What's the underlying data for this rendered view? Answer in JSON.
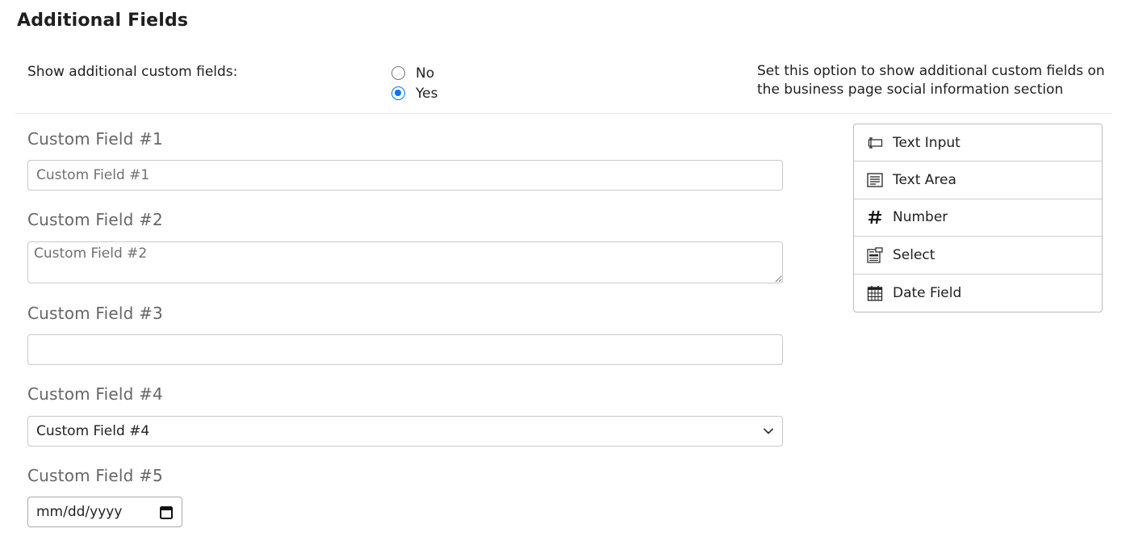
{
  "section": {
    "title": "Additional Fields"
  },
  "show_option": {
    "label": "Show additional custom fields:",
    "options": [
      {
        "label": "No",
        "checked": false
      },
      {
        "label": "Yes",
        "checked": true
      }
    ],
    "help": "Set this option to show additional custom fields on the business page social information section"
  },
  "fields": [
    {
      "label": "Custom Field #1",
      "type": "text",
      "value": "",
      "placeholder": "Custom Field #1"
    },
    {
      "label": "Custom Field #2",
      "type": "textarea",
      "value": "",
      "placeholder": "Custom Field #2"
    },
    {
      "label": "Custom Field #3",
      "type": "number",
      "value": "",
      "placeholder": ""
    },
    {
      "label": "Custom Field #4",
      "type": "select",
      "selected": "Custom Field #4"
    },
    {
      "label": "Custom Field #5",
      "type": "date",
      "placeholder": "mm/dd/yyyy"
    }
  ],
  "toolbox": {
    "items": [
      {
        "label": "Text Input",
        "icon": "text-input-icon"
      },
      {
        "label": "Text Area",
        "icon": "text-area-icon"
      },
      {
        "label": "Number",
        "icon": "hash-icon"
      },
      {
        "label": "Select",
        "icon": "select-icon"
      },
      {
        "label": "Date Field",
        "icon": "calendar-icon"
      }
    ]
  },
  "colors": {
    "accent": "#0075ff",
    "label_gray": "#666666",
    "border": "#c9c9c9"
  }
}
